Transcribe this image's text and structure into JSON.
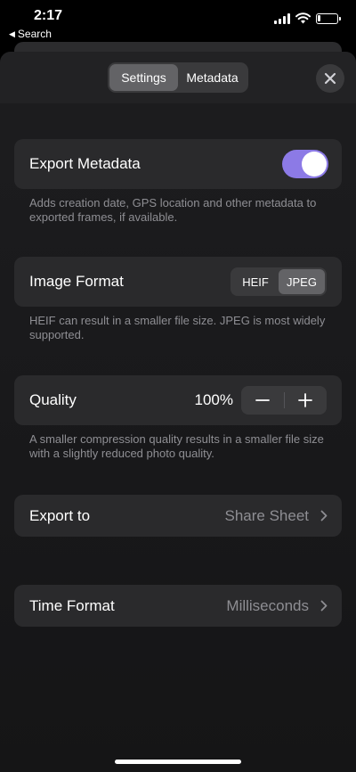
{
  "status_bar": {
    "time": "2:17",
    "back_label": "Search",
    "back_icon": "back-triangle-icon",
    "battery_level_percent": 15
  },
  "header": {
    "tabs": [
      {
        "label": "Settings",
        "active": true
      },
      {
        "label": "Metadata",
        "active": false
      }
    ],
    "close_icon": "close-icon"
  },
  "export_metadata": {
    "label": "Export Metadata",
    "enabled": true,
    "toggle_color": "#8c7ae6",
    "description": "Adds creation date, GPS location and other metadata to exported frames, if available."
  },
  "image_format": {
    "label": "Image Format",
    "options": [
      "HEIF",
      "JPEG"
    ],
    "selected": "JPEG",
    "description": "HEIF can result in a smaller file size. JPEG is most widely supported."
  },
  "quality": {
    "label": "Quality",
    "value": "100%",
    "decrement_icon": "minus-icon",
    "increment_icon": "plus-icon",
    "description": "A smaller compression quality results in a smaller file size with a slightly reduced photo quality."
  },
  "export_to": {
    "label": "Export to",
    "value": "Share Sheet"
  },
  "time_format": {
    "label": "Time Format",
    "value": "Milliseconds"
  },
  "colors": {
    "background": "#1c1c1e",
    "card": "#2a2a2c",
    "secondary_text": "#8e8e93",
    "accent": "#8c7ae6"
  }
}
